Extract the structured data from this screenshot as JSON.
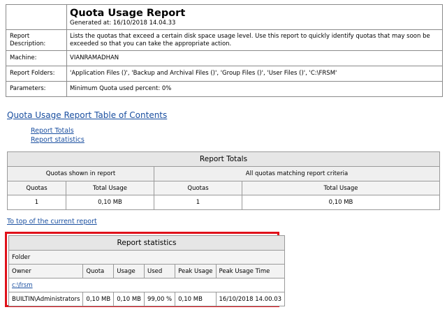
{
  "header": {
    "title": "Quota Usage Report",
    "generated": "Generated at: 16/10/2018 14.04.33",
    "rows": [
      {
        "label": "Report\nDescription:",
        "value": "Lists the quotas that exceed a certain disk space usage level. Use this report to quickly identify quotas that may soon be exceeded so that you can take the appropriate action."
      },
      {
        "label": "Machine:",
        "value": "VIANRAMADHAN"
      },
      {
        "label": "Report Folders:",
        "value": "'Application Files ()', 'Backup and Archival Files ()', 'Group Files ()', 'User Files ()', 'C:\\FRSM'"
      },
      {
        "label": "Parameters:",
        "value": "Minimum Quota used percent: 0%"
      }
    ]
  },
  "toc": {
    "title": "Quota Usage Report Table of Contents",
    "links": [
      "Report Totals",
      "Report statistics"
    ]
  },
  "totals": {
    "caption": "Report Totals",
    "group_left": "Quotas shown in report",
    "group_right": "All quotas matching report criteria",
    "columns": [
      "Quotas",
      "Total Usage",
      "Quotas",
      "Total Usage"
    ],
    "values": [
      "1",
      "0,10 MB",
      "1",
      "0,10 MB"
    ]
  },
  "top_link": "To top of the current report",
  "stats": {
    "caption": "Report statistics",
    "folder_label": "Folder",
    "columns": [
      "Owner",
      "Quota",
      "Usage",
      "Used",
      "Peak Usage",
      "Peak Usage Time"
    ],
    "folder_link": "c:\\frsm",
    "row": [
      "BUILTIN\\Administrators",
      "0,10 MB",
      "0,10 MB",
      "99,00 %",
      "0,10 MB",
      "16/10/2018 14.00.03"
    ]
  }
}
